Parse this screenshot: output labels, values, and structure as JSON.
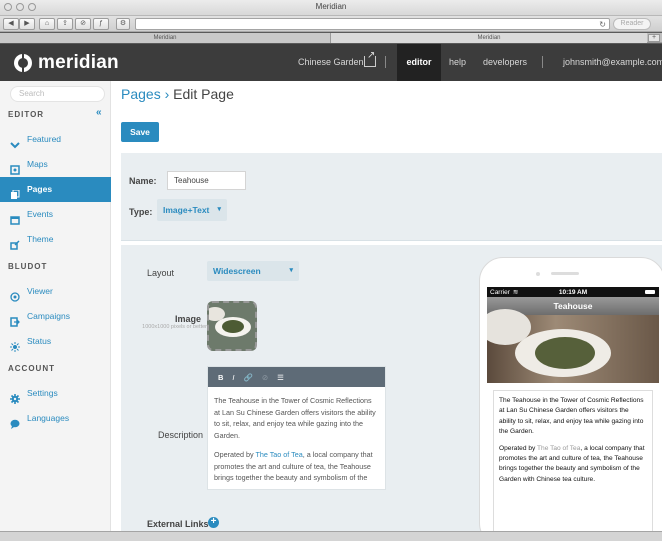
{
  "window": {
    "title": "Meridian"
  },
  "browser": {
    "reader_label": "Reader",
    "tabs": [
      "Meridian",
      "Meridian"
    ]
  },
  "header": {
    "logo_text": "meridian",
    "nav": [
      {
        "label": "Chinese Garden"
      },
      {
        "label": "editor"
      },
      {
        "label": "help"
      },
      {
        "label": "developers"
      },
      {
        "label": "johnsmith@example.com"
      }
    ]
  },
  "sidebar": {
    "search_placeholder": "Search",
    "sections": [
      {
        "heading": "EDITOR",
        "items": [
          {
            "label": "Featured",
            "icon": "chevron-down-icon"
          },
          {
            "label": "Maps",
            "icon": "map-icon"
          },
          {
            "label": "Pages",
            "icon": "pages-icon",
            "active": true
          },
          {
            "label": "Events",
            "icon": "calendar-icon"
          },
          {
            "label": "Theme",
            "icon": "theme-icon"
          }
        ]
      },
      {
        "heading": "BLUDOT",
        "items": [
          {
            "label": "Viewer",
            "icon": "viewer-icon"
          },
          {
            "label": "Campaigns",
            "icon": "campaigns-icon"
          },
          {
            "label": "Status",
            "icon": "status-icon"
          }
        ]
      },
      {
        "heading": "ACCOUNT",
        "items": [
          {
            "label": "Settings",
            "icon": "gear-icon"
          },
          {
            "label": "Languages",
            "icon": "chat-icon"
          }
        ]
      }
    ]
  },
  "main": {
    "breadcrumb": {
      "parent": "Pages",
      "separator": "›",
      "current": "Edit Page"
    },
    "save_label": "Save",
    "name_label": "Name:",
    "name_value": "Teahouse",
    "type_label": "Type:",
    "type_value": "Image+Text",
    "layout_label": "Layout",
    "layout_value": "Widescreen",
    "image_label": "Image",
    "image_hint": "1000x1000 pixels or better",
    "description_label": "Description",
    "editor_toolbar": [
      "B",
      "I",
      "🔗",
      "⊘",
      "☰"
    ],
    "description_p1": "The Teahouse in the Tower of Cosmic Reflections at Lan Su Chinese Garden offers visitors the ability to sit, relax, and enjoy tea while gazing into the Garden.",
    "description_p2_pre": "Operated by ",
    "description_p2_link": "The Tao of Tea",
    "description_p2_post": ", a local company that promotes the art and culture of tea, the Teahouse brings together the beauty and symbolism of the",
    "external_links_label": "External Links"
  },
  "phone": {
    "carrier": "Carrier",
    "time": "10:19 AM",
    "title": "Teahouse",
    "p1": "The Teahouse in the Tower of Cosmic Reflections at Lan Su Chinese Garden offers visitors the ability to sit, relax, and enjoy tea while gazing into the Garden.",
    "p2_pre": "Operated by ",
    "p2_link": "The Tao of Tea",
    "p2_post": ", a local company that promotes the art and culture of tea, the Teahouse brings together the beauty and symbolism of the Garden with Chinese tea culture."
  },
  "colors": {
    "accent": "#2a8bbf",
    "header_bg": "#3c3c3c",
    "panel_bg": "#e9eef1"
  }
}
